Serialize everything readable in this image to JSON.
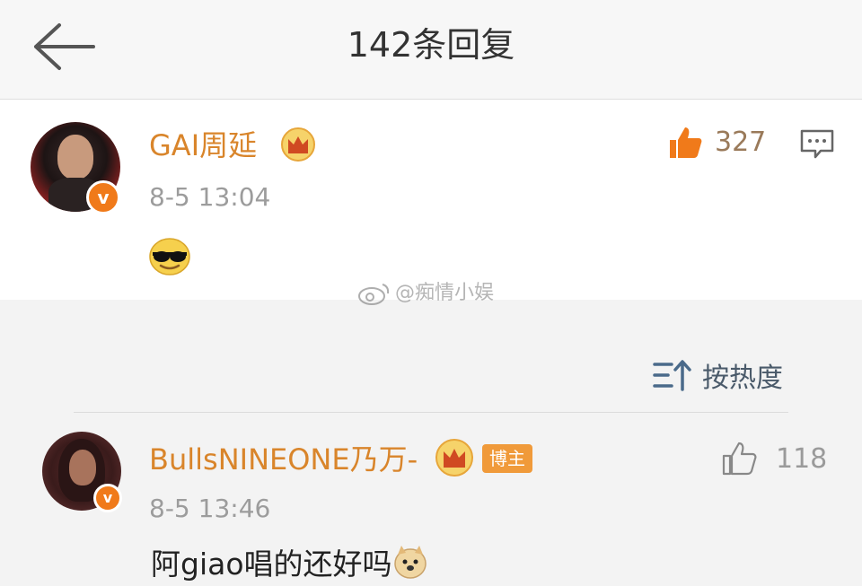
{
  "header": {
    "title": "142条回复",
    "back_icon": "arrow-left-icon"
  },
  "main_comment": {
    "username": "GAI周延",
    "timestamp": "8-5 13:04",
    "like_count": "327",
    "vip_icon": "crown-icon",
    "verified_icon": "v-badge-icon",
    "content_emoji": "sunglasses-emoji",
    "comment_icon": "comment-icon",
    "like_color": "#f07a1a"
  },
  "watermark": {
    "text": "@痴情小娱"
  },
  "sort": {
    "label": "按热度",
    "icon": "sort-icon"
  },
  "reply": {
    "username": "BullsNINEONE乃万-",
    "blogger_tag": "博主",
    "timestamp": "8-5 13:46",
    "like_count": "118",
    "text": "阿giao唱的还好吗",
    "content_emoji": "doge-emoji"
  },
  "colors": {
    "username": "#d9852b",
    "timestamp": "#9c9c9c",
    "accent": "#f07a1a"
  }
}
